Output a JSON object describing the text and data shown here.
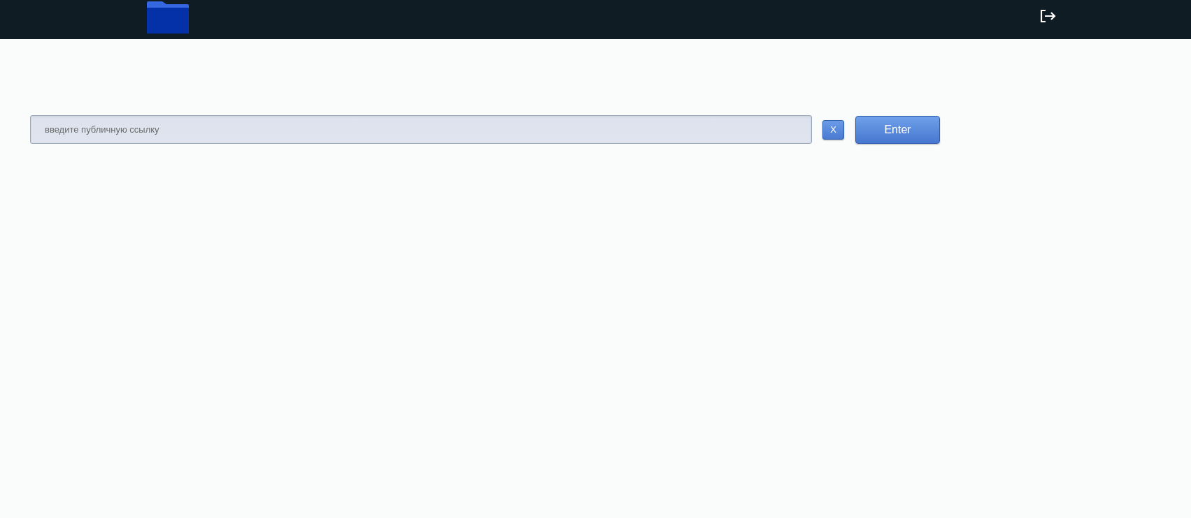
{
  "search": {
    "placeholder": "введите публичную ссылку"
  },
  "clear_button": {
    "label": "X"
  },
  "enter_button": {
    "label": "Enter"
  }
}
